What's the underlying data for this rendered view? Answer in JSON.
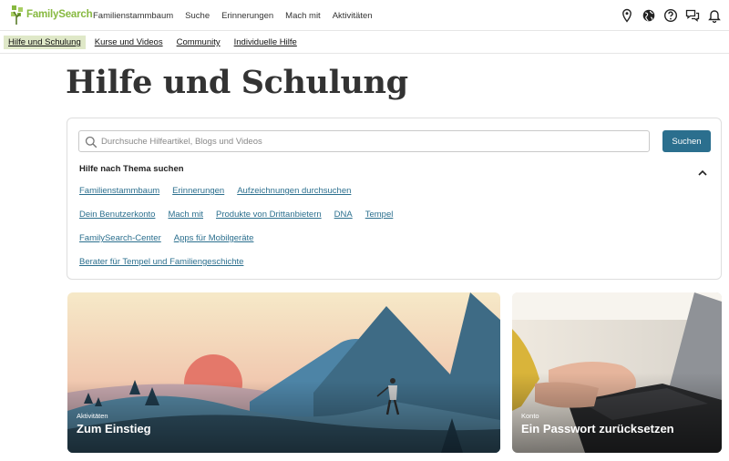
{
  "header": {
    "logo_text": "FamilySearch",
    "nav": [
      "Familienstammbaum",
      "Suche",
      "Erinnerungen",
      "Mach mit",
      "Aktivitäten"
    ],
    "icons": [
      "location-pin-icon",
      "globe-icon",
      "help-icon",
      "chat-icon",
      "bell-icon"
    ]
  },
  "subnav": {
    "items": [
      {
        "label": "Hilfe und Schulung",
        "active": true
      },
      {
        "label": "Kurse und Videos",
        "active": false
      },
      {
        "label": "Community",
        "active": false
      },
      {
        "label": "Individuelle Hilfe",
        "active": false
      }
    ]
  },
  "page": {
    "title": "Hilfe und Schulung"
  },
  "search": {
    "placeholder": "Durchsuche Hilfeartikel, Blogs und Videos",
    "button_label": "Suchen",
    "topic_heading": "Hilfe nach Thema suchen",
    "topic_rows": [
      [
        "Familienstammbaum",
        "Erinnerungen",
        "Aufzeichnungen durchsuchen"
      ],
      [
        "Dein Benutzerkonto",
        "Mach mit",
        "Produkte von Drittanbietern",
        "DNA",
        "Tempel"
      ],
      [
        "FamilySearch-Center",
        "Apps für Mobilgeräte"
      ],
      [
        "Berater für Tempel und Familiengeschichte"
      ]
    ]
  },
  "cards": [
    {
      "eyebrow": "Aktivitäten",
      "title": "Zum Einstieg"
    },
    {
      "eyebrow": "Konto",
      "title": "Ein Passwort zurücksetzen"
    }
  ],
  "colors": {
    "brand_green": "#87b940",
    "accent_blue": "#2b6f8e",
    "active_tab_bg": "#dfe8c8"
  }
}
